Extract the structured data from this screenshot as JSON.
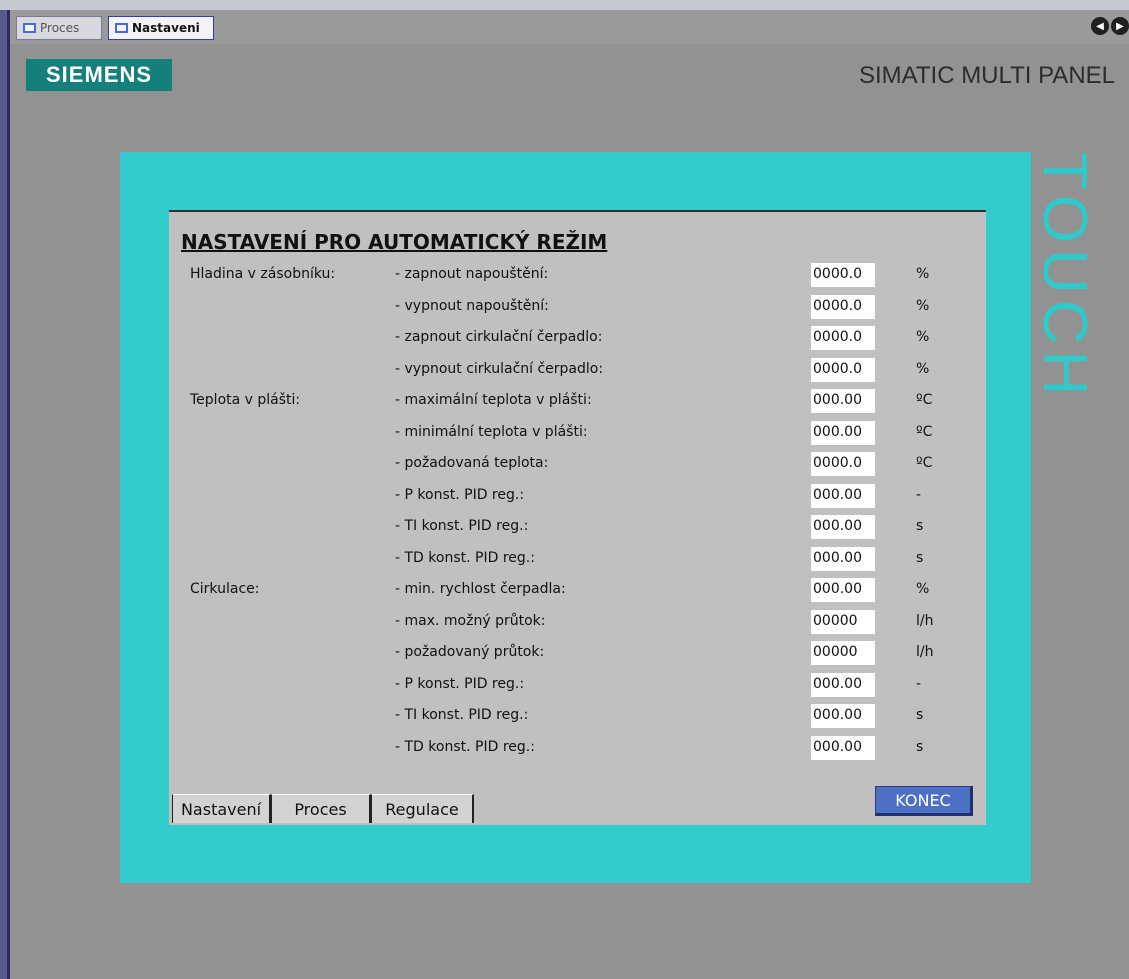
{
  "window_tabs": [
    {
      "label": "Proces",
      "active": false
    },
    {
      "label": "Nastaveni",
      "active": true
    }
  ],
  "header": {
    "brand": "SIEMENS",
    "product": "SIMATIC MULTI PANEL",
    "side_text": "TOUCH"
  },
  "panel": {
    "title": "NASTAVENÍ PRO AUTOMATICKÝ REŽIM",
    "rows": [
      {
        "category": "Hladina v zásobníku:",
        "label": "- zapnout napouštění:",
        "value": "0000.0",
        "unit": "%"
      },
      {
        "category": "",
        "label": "- vypnout napouštění:",
        "value": "0000.0",
        "unit": "%"
      },
      {
        "category": "",
        "label": "- zapnout cirkulační čerpadlo:",
        "value": "0000.0",
        "unit": "%"
      },
      {
        "category": "",
        "label": "- vypnout cirkulační čerpadlo:",
        "value": "0000.0",
        "unit": "%"
      },
      {
        "category": "Teplota v plášti:",
        "label": "- maximální teplota v plášti:",
        "value": "000.00",
        "unit": "ºC"
      },
      {
        "category": "",
        "label": "- minimální teplota v plášti:",
        "value": "000.00",
        "unit": "ºC"
      },
      {
        "category": "",
        "label": "- požadovaná teplota:",
        "value": "0000.0",
        "unit": "ºC"
      },
      {
        "category": "",
        "label": "- P konst. PID reg.:",
        "value": "000.00",
        "unit": "-"
      },
      {
        "category": "",
        "label": "- TI konst. PID reg.:",
        "value": "000.00",
        "unit": "s"
      },
      {
        "category": "",
        "label": "- TD konst. PID reg.:",
        "value": "000.00",
        "unit": "s"
      },
      {
        "category": "Cirkulace:",
        "label": "- min. rychlost čerpadla:",
        "value": "000.00",
        "unit": "%"
      },
      {
        "category": "",
        "label": "- max. možný průtok:",
        "value": "00000",
        "unit": "l/h"
      },
      {
        "category": "",
        "label": "- požadovaný průtok:",
        "value": "00000",
        "unit": "l/h"
      },
      {
        "category": "",
        "label": "- P konst. PID reg.:",
        "value": "000.00",
        "unit": "-"
      },
      {
        "category": "",
        "label": "- TI konst. PID reg.:",
        "value": "000.00",
        "unit": "s"
      },
      {
        "category": "",
        "label": "- TD konst. PID reg.:",
        "value": "000.00",
        "unit": "s"
      }
    ],
    "bottom_tabs": {
      "nastaveni": "Nastavení",
      "proces": "Proces",
      "regulace": "Regulace"
    },
    "konec_label": "KONEC"
  }
}
